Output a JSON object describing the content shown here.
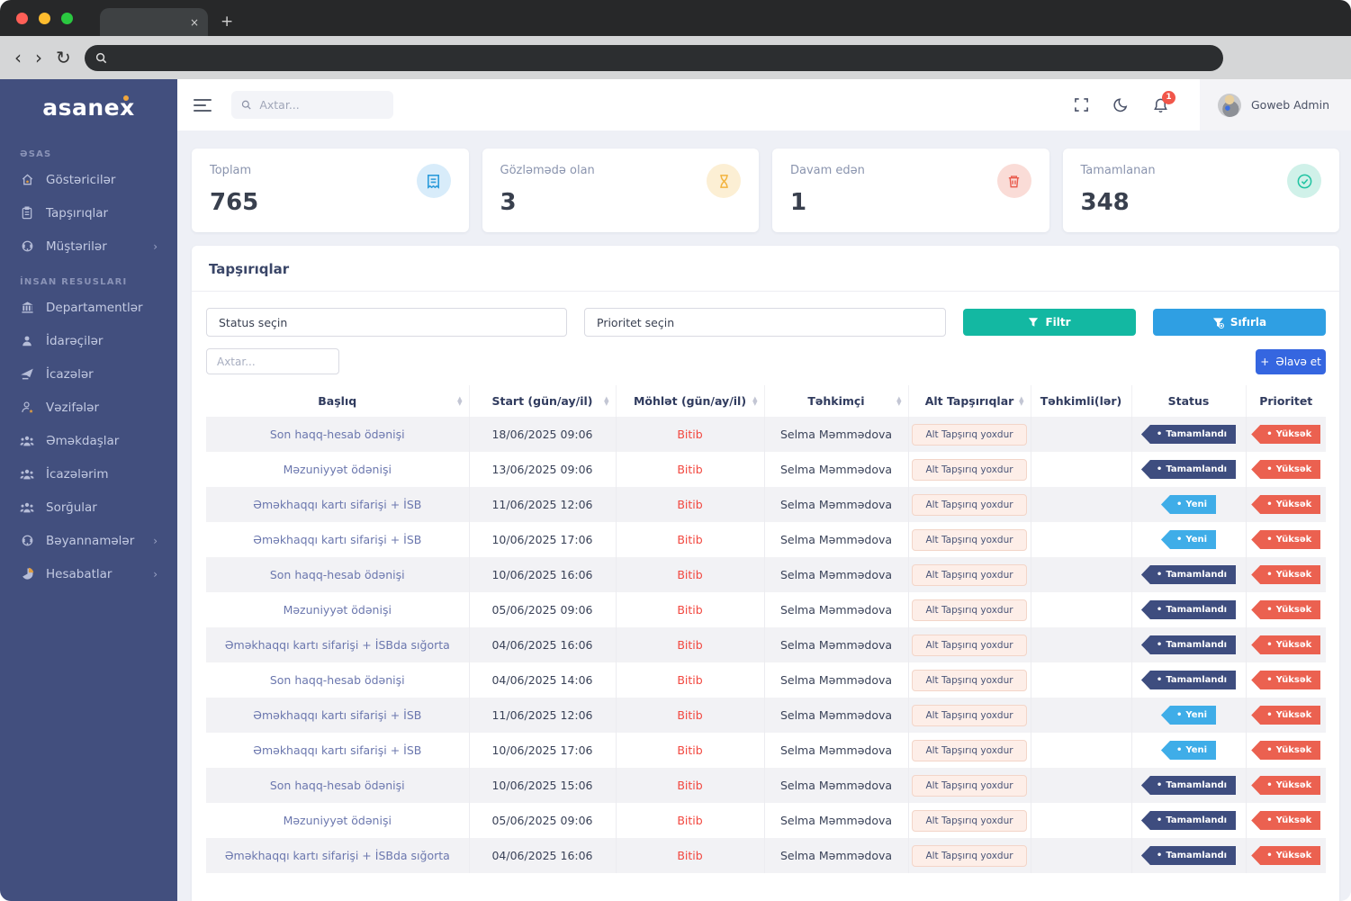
{
  "sidebar": {
    "logo": "asanex",
    "sections": [
      {
        "label": "ƏSAS",
        "items": [
          {
            "label": "Göstəricilər",
            "icon": "home-icon",
            "chevron": false
          },
          {
            "label": "Tapşırıqlar",
            "icon": "clipboard-icon",
            "chevron": false
          },
          {
            "label": "Müştərilər",
            "icon": "headset-icon",
            "chevron": true
          }
        ]
      },
      {
        "label": "İNSAN RESUSLARI",
        "items": [
          {
            "label": "Departamentlər",
            "icon": "building-icon",
            "chevron": false
          },
          {
            "label": "İdarəçilər",
            "icon": "person-icon",
            "chevron": false
          },
          {
            "label": "İcazələr",
            "icon": "send-icon",
            "chevron": false
          },
          {
            "label": "Vəzifələr",
            "icon": "person-star-icon",
            "chevron": false
          },
          {
            "label": "Əməkdaşlar",
            "icon": "people-icon",
            "chevron": false
          },
          {
            "label": "İcazələrim",
            "icon": "people-icon",
            "chevron": false
          },
          {
            "label": "Sorğular",
            "icon": "people-icon",
            "chevron": false
          },
          {
            "label": "Bəyannamələr",
            "icon": "headset-icon",
            "chevron": true
          },
          {
            "label": "Hesabatlar",
            "icon": "pie-icon",
            "chevron": true
          }
        ]
      }
    ]
  },
  "header": {
    "search_placeholder": "Axtar...",
    "notification_count": "1",
    "user_name": "Goweb Admin"
  },
  "cards": [
    {
      "label": "Toplam",
      "value": "765",
      "icon": "tasks-icon",
      "icon_color": "#2d9cdb",
      "icon_bg": "#d8ecfa"
    },
    {
      "label": "Gözləmədə olan",
      "value": "3",
      "icon": "hourglass-icon",
      "icon_color": "#f2b33d",
      "icon_bg": "#fcefd4"
    },
    {
      "label": "Davam edən",
      "value": "1",
      "icon": "trash-icon",
      "icon_color": "#e95c4e",
      "icon_bg": "#fadcd7"
    },
    {
      "label": "Tamamlanan",
      "value": "348",
      "icon": "check-circle-icon",
      "icon_color": "#1fc3a1",
      "icon_bg": "#d0f1e9"
    }
  ],
  "panel": {
    "title": "Tapşırıqlar",
    "status_placeholder": "Status seçin",
    "priority_placeholder": "Prioritet seçin",
    "search_placeholder": "Axtar...",
    "filter_button": "Filtr",
    "reset_button": "Sıfırla",
    "add_button": "Əlavə et"
  },
  "table": {
    "columns": [
      {
        "label": "Başlıq",
        "sortable": true
      },
      {
        "label": "Start (gün/ay/il)",
        "sortable": true
      },
      {
        "label": "Möhlət (gün/ay/il)",
        "sortable": true
      },
      {
        "label": "Təhkimçi",
        "sortable": true
      },
      {
        "label": "Alt Tapşırıqlar",
        "sortable": true
      },
      {
        "label": "Təhkimli(lər)",
        "sortable": false
      },
      {
        "label": "Status",
        "sortable": false
      },
      {
        "label": "Prioritet",
        "sortable": false
      }
    ],
    "status_colors": {
      "done": "#3e4d7f",
      "new": "#3fade8"
    },
    "priority_color": "#eb6150",
    "rows": [
      {
        "title": "Son haqq-hesab ödənişi",
        "start": "18/06/2025 09:06",
        "deadline": "Bitib",
        "assignee": "Selma Məmmədova",
        "subtasks": "Alt Tapşırıq yoxdur",
        "avatar": "a",
        "status": "Tamamlandı",
        "status_type": "done",
        "priority": "Yüksək"
      },
      {
        "title": "Məzuniyyət ödənişi",
        "start": "13/06/2025 09:06",
        "deadline": "Bitib",
        "assignee": "Selma Məmmədova",
        "subtasks": "Alt Tapşırıq yoxdur",
        "avatar": "a",
        "status": "Tamamlandı",
        "status_type": "done",
        "priority": "Yüksək"
      },
      {
        "title": "Əməkhaqqı kartı sifarişi + İSB",
        "start": "11/06/2025 12:06",
        "deadline": "Bitib",
        "assignee": "Selma Məmmədova",
        "subtasks": "Alt Tapşırıq yoxdur",
        "avatar": "a",
        "status": "Yeni",
        "status_type": "new",
        "priority": "Yüksək"
      },
      {
        "title": "Əməkhaqqı kartı sifarişi + İSB",
        "start": "10/06/2025 17:06",
        "deadline": "Bitib",
        "assignee": "Selma Məmmədova",
        "subtasks": "Alt Tapşırıq yoxdur",
        "avatar": "b",
        "status": "Yeni",
        "status_type": "new",
        "priority": "Yüksək"
      },
      {
        "title": "Son haqq-hesab ödənişi",
        "start": "10/06/2025 16:06",
        "deadline": "Bitib",
        "assignee": "Selma Məmmədova",
        "subtasks": "Alt Tapşırıq yoxdur",
        "avatar": "a",
        "status": "Tamamlandı",
        "status_type": "done",
        "priority": "Yüksək"
      },
      {
        "title": "Məzuniyyət ödənişi",
        "start": "05/06/2025 09:06",
        "deadline": "Bitib",
        "assignee": "Selma Məmmədova",
        "subtasks": "Alt Tapşırıq yoxdur",
        "avatar": "b",
        "status": "Tamamlandı",
        "status_type": "done",
        "priority": "Yüksək"
      },
      {
        "title": "Əməkhaqqı kartı sifarişi + İSBda sığorta",
        "start": "04/06/2025 16:06",
        "deadline": "Bitib",
        "assignee": "Selma Məmmədova",
        "subtasks": "Alt Tapşırıq yoxdur",
        "avatar": "b",
        "status": "Tamamlandı",
        "status_type": "done",
        "priority": "Yüksək"
      },
      {
        "title": "Son haqq-hesab ödənişi",
        "start": "04/06/2025 14:06",
        "deadline": "Bitib",
        "assignee": "Selma Məmmədova",
        "subtasks": "Alt Tapşırıq yoxdur",
        "avatar": "b",
        "status": "Tamamlandı",
        "status_type": "done",
        "priority": "Yüksək"
      },
      {
        "title": "Əməkhaqqı kartı sifarişi + İSB",
        "start": "11/06/2025 12:06",
        "deadline": "Bitib",
        "assignee": "Selma Məmmədova",
        "subtasks": "Alt Tapşırıq yoxdur",
        "avatar": "a",
        "status": "Yeni",
        "status_type": "new",
        "priority": "Yüksək"
      },
      {
        "title": "Əməkhaqqı kartı sifarişi + İSB",
        "start": "10/06/2025 17:06",
        "deadline": "Bitib",
        "assignee": "Selma Məmmədova",
        "subtasks": "Alt Tapşırıq yoxdur",
        "avatar": "b",
        "status": "Yeni",
        "status_type": "new",
        "priority": "Yüksək"
      },
      {
        "title": "Son haqq-hesab ödənişi",
        "start": "10/06/2025 15:06",
        "deadline": "Bitib",
        "assignee": "Selma Məmmədova",
        "subtasks": "Alt Tapşırıq yoxdur",
        "avatar": "a",
        "status": "Tamamlandı",
        "status_type": "done",
        "priority": "Yüksək"
      },
      {
        "title": "Məzuniyyət ödənişi",
        "start": "05/06/2025 09:06",
        "deadline": "Bitib",
        "assignee": "Selma Məmmədova",
        "subtasks": "Alt Tapşırıq yoxdur",
        "avatar": "b",
        "status": "Tamamlandı",
        "status_type": "done",
        "priority": "Yüksək"
      },
      {
        "title": "Əməkhaqqı kartı sifarişi + İSBda sığorta",
        "start": "04/06/2025 16:06",
        "deadline": "Bitib",
        "assignee": "Selma Məmmədova",
        "subtasks": "Alt Tapşırıq yoxdur",
        "avatar": "b",
        "status": "Tamamlandı",
        "status_type": "done",
        "priority": "Yüksək"
      }
    ]
  }
}
